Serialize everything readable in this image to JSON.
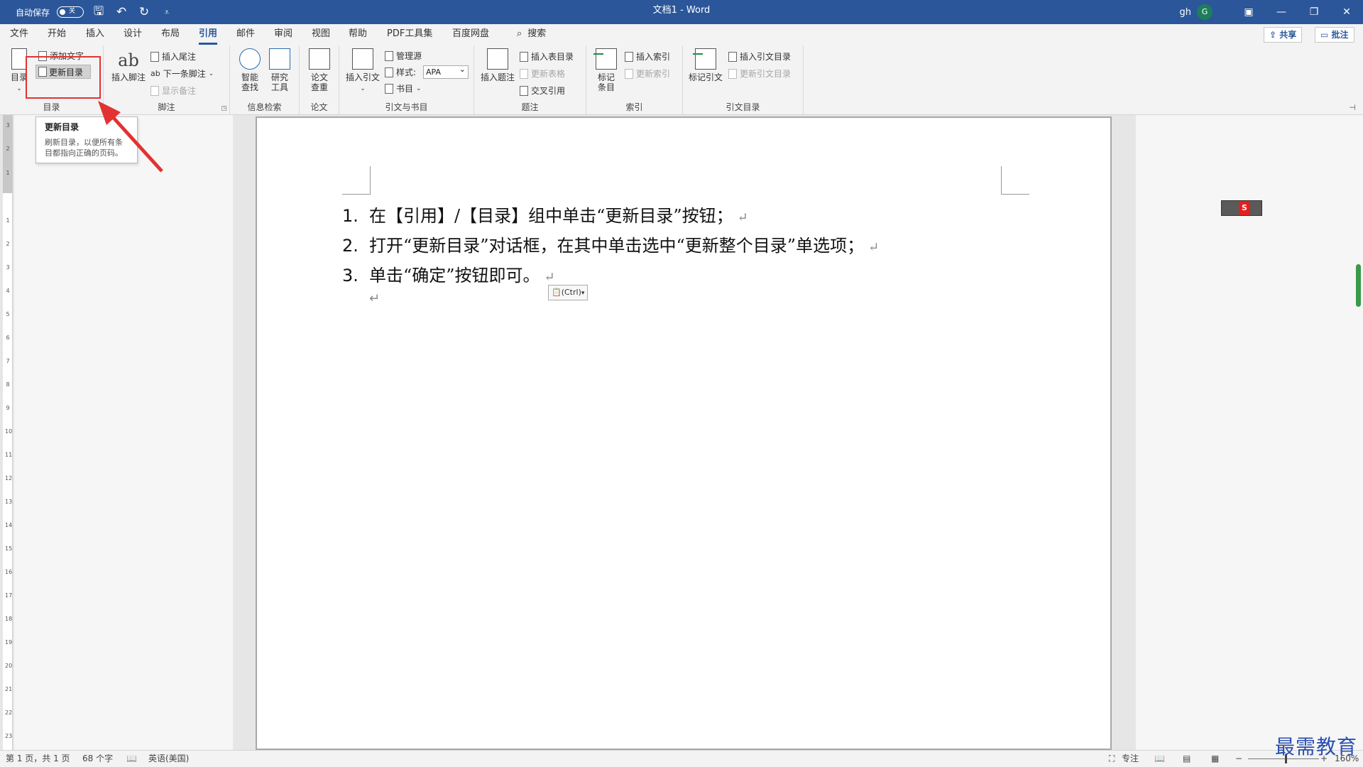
{
  "titlebar": {
    "autosave_label": "自动保存",
    "autosave_state": "关",
    "doc_title": "文档1 - Word",
    "user_name": "gh",
    "avatar_letter": "G"
  },
  "tabs": [
    "文件",
    "开始",
    "插入",
    "设计",
    "布局",
    "引用",
    "邮件",
    "审阅",
    "视图",
    "帮助",
    "PDF工具集",
    "百度网盘"
  ],
  "active_tab": "引用",
  "search_label": "搜索",
  "share_label": "共享",
  "comment_label": "批注",
  "ribbon": {
    "toc": {
      "toc_btn": "目录",
      "add_text": "添加文字",
      "update_toc": "更新目录",
      "group_label": "目录"
    },
    "footnotes": {
      "insert_footnote": "插入脚注",
      "insert_endnote": "插入尾注",
      "next_footnote": "下一条脚注",
      "show_notes": "显示备注",
      "group_label": "脚注"
    },
    "research": {
      "smart_lookup_1": "智能",
      "smart_lookup_2": "查找",
      "researcher_1": "研究",
      "researcher_2": "工具",
      "group_label": "信息检索"
    },
    "paper": {
      "check_1": "论文",
      "check_2": "查重",
      "group_label": "论文"
    },
    "citations": {
      "insert_citation": "插入引文",
      "manage_sources": "管理源",
      "style_label": "样式:",
      "style_value": "APA",
      "bibliography": "书目",
      "group_label": "引文与书目"
    },
    "captions": {
      "insert_caption": "插入题注",
      "insert_table_of_figures": "插入表目录",
      "update_table": "更新表格",
      "cross_reference": "交叉引用",
      "group_label": "题注"
    },
    "index": {
      "mark_entry_1": "标记",
      "mark_entry_2": "条目",
      "insert_index": "插入索引",
      "update_index": "更新索引",
      "group_label": "索引"
    },
    "toa": {
      "mark_citation": "标记引文",
      "insert_toa": "插入引文目录",
      "update_toa": "更新引文目录",
      "group_label": "引文目录"
    }
  },
  "tooltip": {
    "title": "更新目录",
    "desc_line1": "刷新目录，以便所有条",
    "desc_line2": "目都指向正确的页码。"
  },
  "document": {
    "lines": [
      {
        "num": "1.",
        "text": "在【引用】/【目录】组中单击“更新目录”按钮；"
      },
      {
        "num": "2.",
        "text": "打开“更新目录”对话框，在其中单击选中“更新整个目录”单选项；"
      },
      {
        "num": "3.",
        "text": "单击“确定”按钮即可。"
      }
    ],
    "paste_options": "(Ctrl)",
    "para_mark": "↵"
  },
  "ruler_numbers": [
    "3",
    "2",
    "1",
    "1",
    "2",
    "3",
    "4",
    "5",
    "6",
    "7",
    "8",
    "9",
    "10",
    "11",
    "12",
    "13",
    "14",
    "15",
    "16",
    "17",
    "18",
    "19",
    "20",
    "21",
    "22",
    "23"
  ],
  "statusbar": {
    "page": "第 1 页，共 1 页",
    "words": "68 个字",
    "language": "英语(美国)",
    "focus": "专注",
    "zoom": "160%"
  },
  "watermark": "最需教育",
  "colors": {
    "title_bg": "#2b579a",
    "highlight": "#e23232",
    "arrow": "#e23232"
  }
}
